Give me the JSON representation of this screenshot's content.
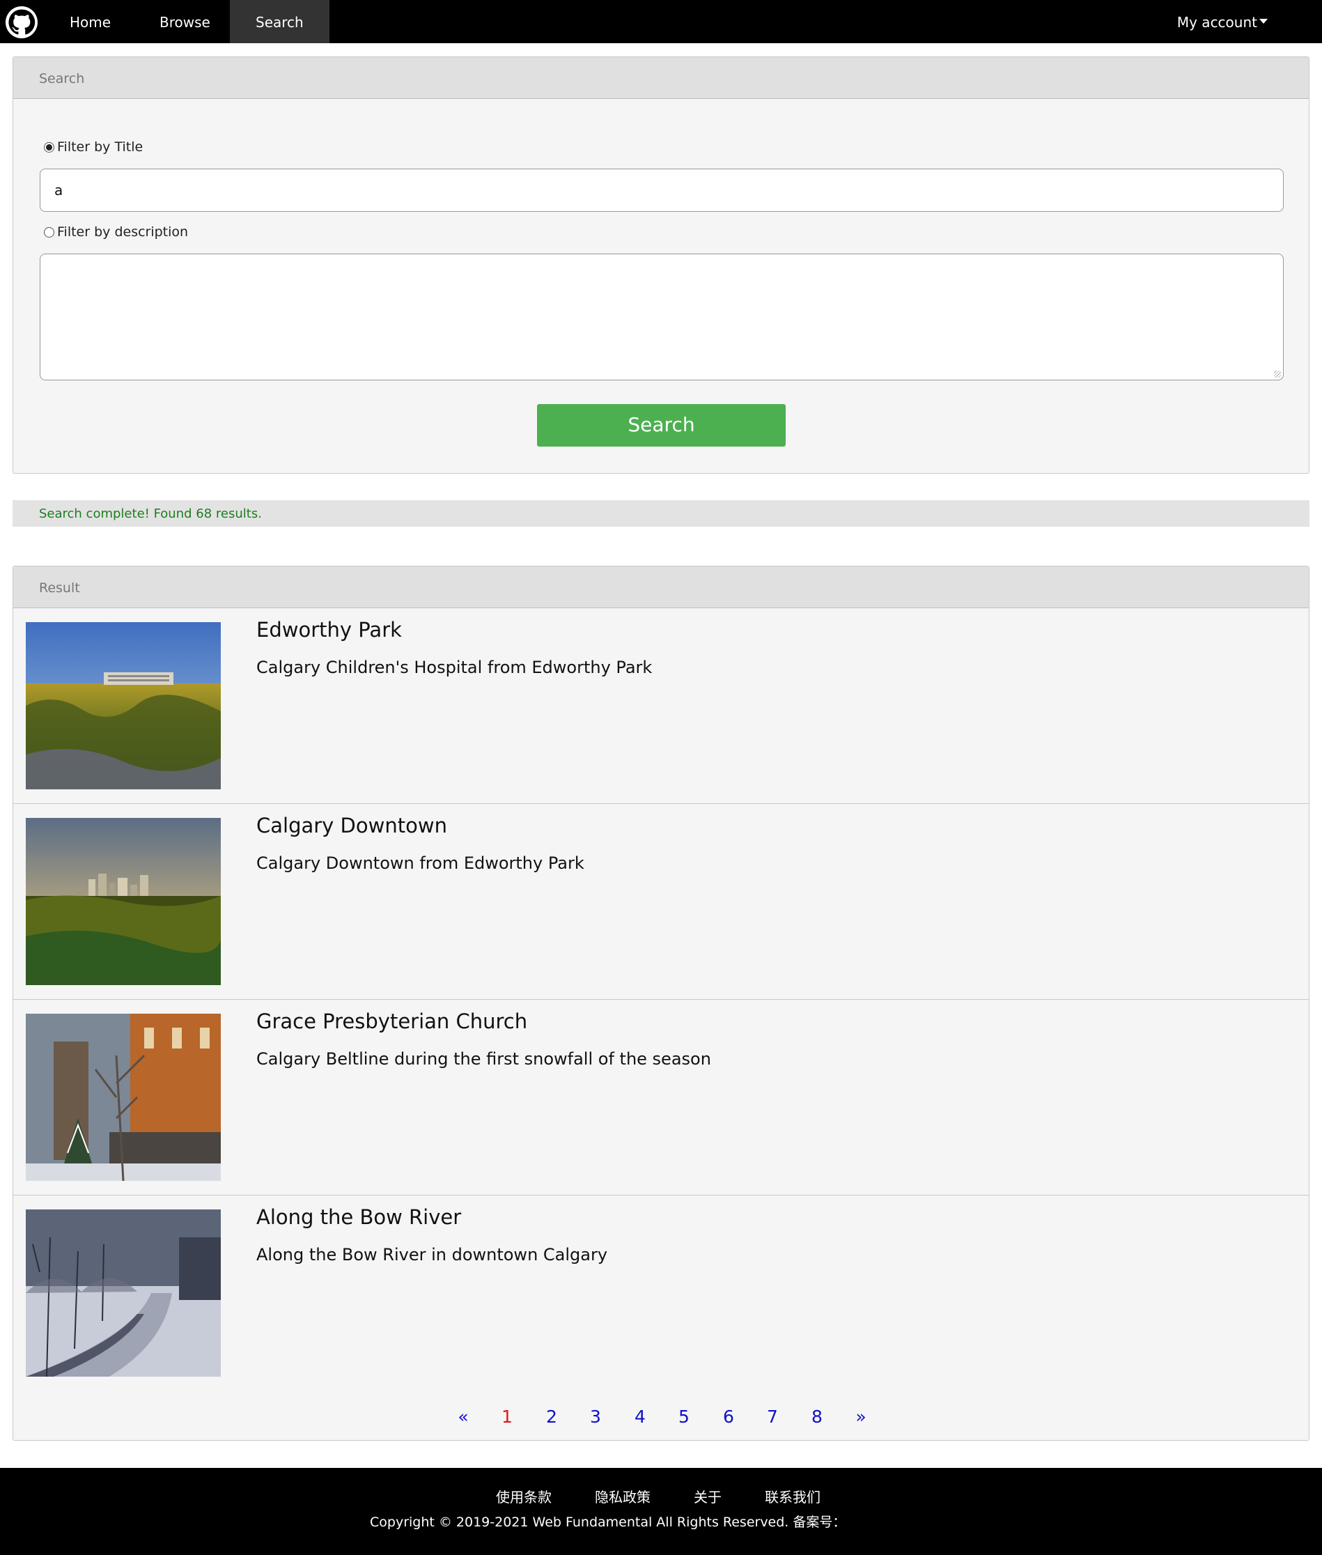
{
  "nav": {
    "logo_icon": "github-icon",
    "items": [
      {
        "label": "Home"
      },
      {
        "label": "Browse"
      },
      {
        "label": "Search"
      }
    ],
    "account_label": "My account"
  },
  "search_panel": {
    "header": "Search",
    "filter_title_label": "Filter by Title",
    "filter_title_checked": true,
    "title_value": "a",
    "filter_desc_label": "Filter by description",
    "filter_desc_checked": false,
    "desc_value": "",
    "button_label": "Search",
    "button_color": "#4caf50"
  },
  "status": {
    "message": "Search complete! Found 68 results.",
    "color": "#1e7d1e"
  },
  "results": {
    "header": "Result",
    "items": [
      {
        "title": "Edworthy Park",
        "description": "Calgary Children's Hospital from Edworthy Park",
        "image": "landscape-park-hospital-photo"
      },
      {
        "title": "Calgary Downtown",
        "description": "Calgary Downtown from Edworthy Park",
        "image": "city-skyline-photo"
      },
      {
        "title": "Grace Presbyterian Church",
        "description": "Calgary Beltline during the first snowfall of the season",
        "image": "snowy-church-photo"
      },
      {
        "title": "Along the Bow River",
        "description": "Along the Bow River in downtown Calgary",
        "image": "snowy-path-photo"
      }
    ]
  },
  "pagination": {
    "prev": "«",
    "pages": [
      "1",
      "2",
      "3",
      "4",
      "5",
      "6",
      "7",
      "8"
    ],
    "current": "1",
    "next": "»",
    "active_color": "#e0141e",
    "link_color": "#1010c8"
  },
  "footer": {
    "links": [
      "使用条款",
      "隐私政策",
      "关于",
      "联系我们"
    ],
    "copyright": "Copyright © 2019-2021 Web Fundamental All Rights Reserved. 备案号："
  }
}
